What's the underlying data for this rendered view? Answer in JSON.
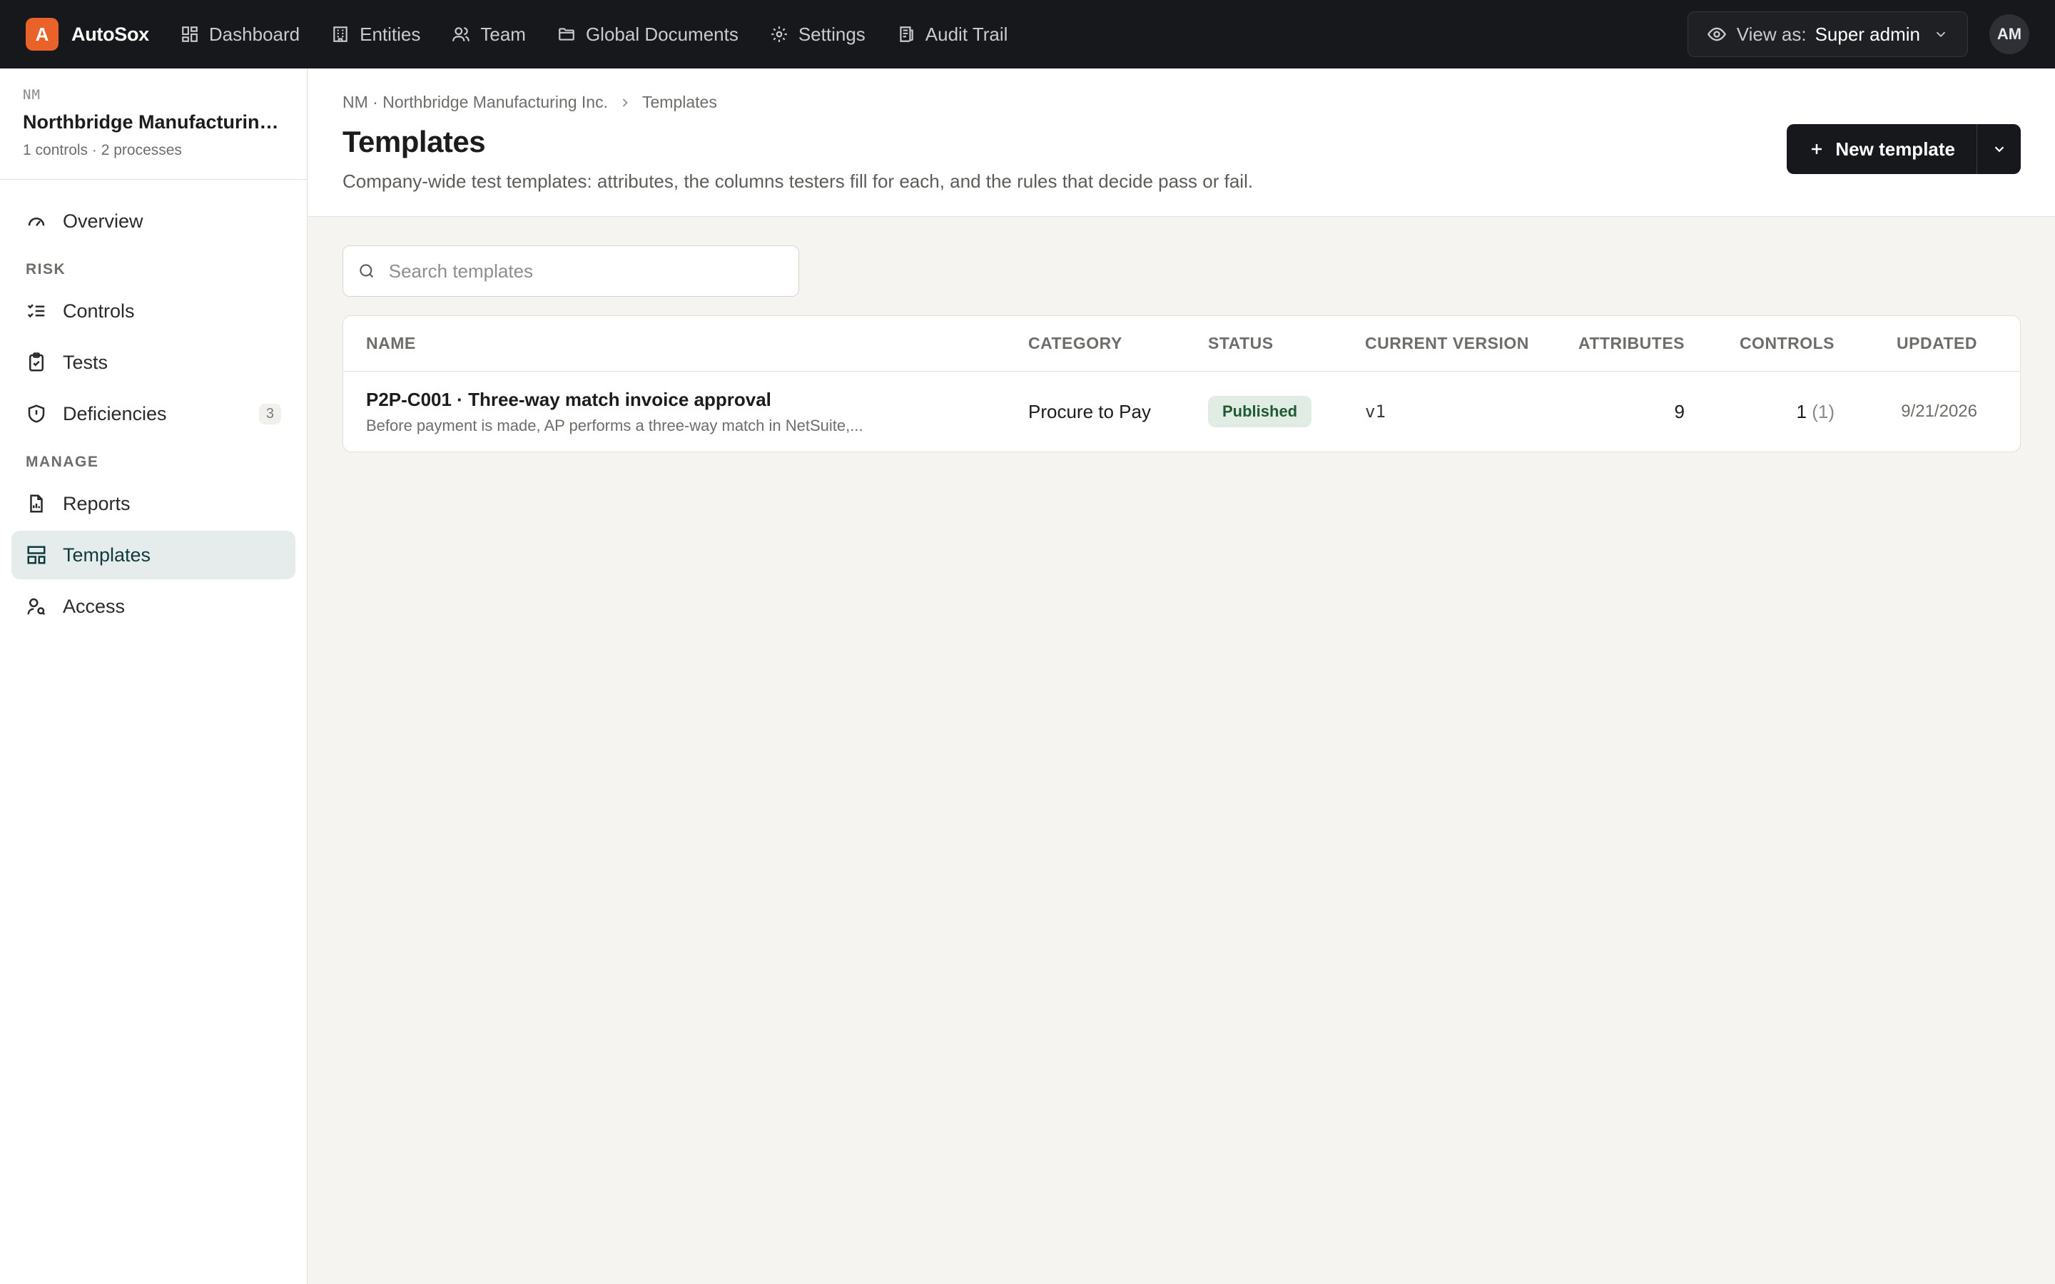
{
  "app": {
    "logo_letter": "A",
    "name": "AutoSox"
  },
  "topnav": [
    {
      "label": "Dashboard",
      "icon": "dashboard-icon"
    },
    {
      "label": "Entities",
      "icon": "building-icon"
    },
    {
      "label": "Team",
      "icon": "users-icon"
    },
    {
      "label": "Global Documents",
      "icon": "folder-icon"
    },
    {
      "label": "Settings",
      "icon": "gear-icon"
    },
    {
      "label": "Audit Trail",
      "icon": "audit-icon"
    }
  ],
  "view_as": {
    "label": "View as:",
    "value": "Super admin"
  },
  "user": {
    "initials": "AM"
  },
  "org": {
    "code": "NM",
    "name": "Northbridge Manufacturing Inc.",
    "meta": "1 controls · 2 processes"
  },
  "sidebar": {
    "overview": "Overview",
    "risk_label": "RISK",
    "controls": "Controls",
    "tests": "Tests",
    "deficiencies": "Deficiencies",
    "deficiencies_count": "3",
    "manage_label": "MANAGE",
    "reports": "Reports",
    "templates": "Templates",
    "access": "Access"
  },
  "breadcrumb": {
    "org": "NM · Northbridge Manufacturing Inc.",
    "current": "Templates"
  },
  "page": {
    "title": "Templates",
    "subtitle": "Company-wide test templates: attributes, the columns testers fill for each, and the rules that decide pass or fail.",
    "new_button": "New template"
  },
  "search": {
    "placeholder": "Search templates",
    "value": ""
  },
  "table": {
    "headers": {
      "name": "NAME",
      "category": "CATEGORY",
      "status": "STATUS",
      "version": "CURRENT VERSION",
      "attributes": "ATTRIBUTES",
      "controls": "CONTROLS",
      "updated": "UPDATED"
    },
    "rows": [
      {
        "title": "P2P-C001 · Three-way match invoice approval",
        "description": "Before payment is made, AP performs a three-way match in NetSuite,...",
        "category": "Procure to Pay",
        "status": "Published",
        "version": "v1",
        "attributes": "9",
        "controls": "1",
        "controls_sub": "(1)",
        "updated": "9/21/2026"
      }
    ]
  },
  "colors": {
    "accent": "#e8622a",
    "topbar": "#17181b",
    "active_nav": "#e6ecec",
    "published_badge": "#e1ede4"
  }
}
